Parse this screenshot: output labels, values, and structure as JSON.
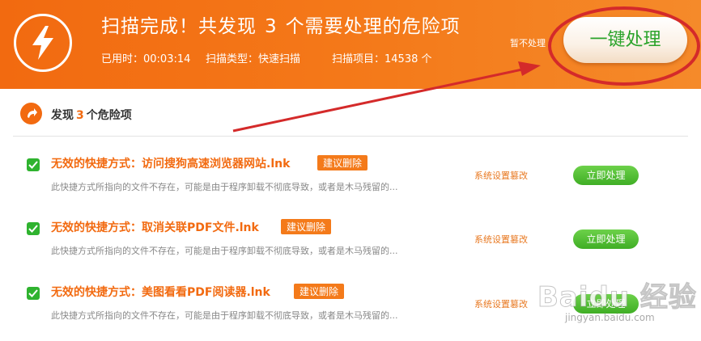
{
  "header": {
    "title_prefix": "扫描完成！共发现",
    "count": "3",
    "title_suffix": "个需要处理的危险项",
    "elapsed": "已用时：00:03:14",
    "scan_type": "扫描类型：快速扫描",
    "scan_items": "扫描项目：14538 个",
    "skip_label": "暂不处理",
    "one_key_label": "一键处理",
    "icon": "lightning-bolt-icon"
  },
  "summary": {
    "prefix": "发现",
    "count": "3",
    "suffix": "个危险项",
    "icon": "arrow-icon"
  },
  "items": [
    {
      "title": "无效的快捷方式：访问搜狗高速浏览器网站.lnk",
      "tag": "建议删除",
      "description": "此快捷方式所指向的文件不存在，可能是由于程序卸载不彻底导致，或者是木马残留的...",
      "category": "系统设置篡改",
      "action": "立即处理"
    },
    {
      "title": "无效的快捷方式：取消关联PDF文件.lnk",
      "tag": "建议删除",
      "description": "此快捷方式所指向的文件不存在，可能是由于程序卸载不彻底导致，或者是木马残留的...",
      "category": "系统设置篡改",
      "action": "立即处理"
    },
    {
      "title": "无效的快捷方式：美图看看PDF阅读器.lnk",
      "tag": "建议删除",
      "description": "此快捷方式所指向的文件不存在，可能是由于程序卸载不彻底导致，或者是木马残留的...",
      "category": "系统设置篡改",
      "action": "立即处理"
    }
  ],
  "watermark": {
    "main": "Baidu 经验",
    "sub": "jingyan.baidu.com"
  },
  "colors": {
    "brand_orange": "#f26a10",
    "action_green": "#3fae25",
    "annotation_red": "#d42a2a"
  }
}
